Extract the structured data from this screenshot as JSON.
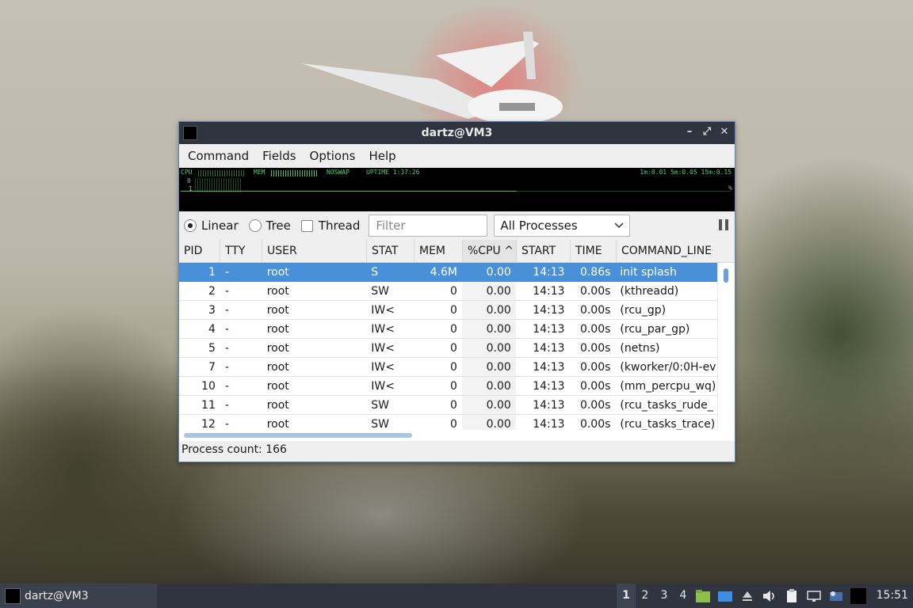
{
  "window": {
    "title": "dartz@VM3",
    "controls": {
      "minimize": "–",
      "maximize": "⤢",
      "close": "✕"
    }
  },
  "menu": [
    "Command",
    "Fields",
    "Options",
    "Help"
  ],
  "meters": {
    "cpu_label": "CPU",
    "cpu_value": "0",
    "mem_label": "MEM",
    "noswap": "NOSWAP",
    "uptime": "UPTIME 1:37:26",
    "load": "1m:0.01 5m:0.05 15m:0.15",
    "row3": "1",
    "pct": "%"
  },
  "toolbar": {
    "linear": "Linear",
    "tree": "Tree",
    "thread": "Thread",
    "filter_placeholder": "Filter",
    "process_filter": "All Processes",
    "selected_view": "Linear"
  },
  "table": {
    "columns": [
      "PID",
      "TTY",
      "USER",
      "STAT",
      "MEM",
      "%CPU",
      "START",
      "TIME",
      "COMMAND_LINE"
    ],
    "sort_indicator": "^",
    "rows": [
      {
        "pid": "1",
        "tty": "-",
        "user": "root",
        "stat": "S",
        "mem": "4.6M",
        "cpu": "0.00",
        "start": "14:13",
        "time": "0.86s",
        "cmd": "init splash",
        "selected": true
      },
      {
        "pid": "2",
        "tty": "-",
        "user": "root",
        "stat": "SW",
        "mem": "0",
        "cpu": "0.00",
        "start": "14:13",
        "time": "0.00s",
        "cmd": "(kthreadd)"
      },
      {
        "pid": "3",
        "tty": "-",
        "user": "root",
        "stat": "IW<",
        "mem": "0",
        "cpu": "0.00",
        "start": "14:13",
        "time": "0.00s",
        "cmd": "(rcu_gp)"
      },
      {
        "pid": "4",
        "tty": "-",
        "user": "root",
        "stat": "IW<",
        "mem": "0",
        "cpu": "0.00",
        "start": "14:13",
        "time": "0.00s",
        "cmd": "(rcu_par_gp)"
      },
      {
        "pid": "5",
        "tty": "-",
        "user": "root",
        "stat": "IW<",
        "mem": "0",
        "cpu": "0.00",
        "start": "14:13",
        "time": "0.00s",
        "cmd": "(netns)"
      },
      {
        "pid": "7",
        "tty": "-",
        "user": "root",
        "stat": "IW<",
        "mem": "0",
        "cpu": "0.00",
        "start": "14:13",
        "time": "0.00s",
        "cmd": "(kworker/0:0H-ev"
      },
      {
        "pid": "10",
        "tty": "-",
        "user": "root",
        "stat": "IW<",
        "mem": "0",
        "cpu": "0.00",
        "start": "14:13",
        "time": "0.00s",
        "cmd": "(mm_percpu_wq)"
      },
      {
        "pid": "11",
        "tty": "-",
        "user": "root",
        "stat": "SW",
        "mem": "0",
        "cpu": "0.00",
        "start": "14:13",
        "time": "0.00s",
        "cmd": "(rcu_tasks_rude_"
      },
      {
        "pid": "12",
        "tty": "-",
        "user": "root",
        "stat": "SW",
        "mem": "0",
        "cpu": "0.00",
        "start": "14:13",
        "time": "0.00s",
        "cmd": "(rcu_tasks_trace)"
      }
    ]
  },
  "status": {
    "process_count": "Process count: 166"
  },
  "taskbar": {
    "task_title": "dartz@VM3",
    "workspaces": [
      "1",
      "2",
      "3",
      "4"
    ],
    "active_workspace": "1",
    "clock": "15:51"
  },
  "colors": {
    "selection": "#4a90d9",
    "titlebar": "#2f343f",
    "meter_green": "#4fd07a"
  }
}
